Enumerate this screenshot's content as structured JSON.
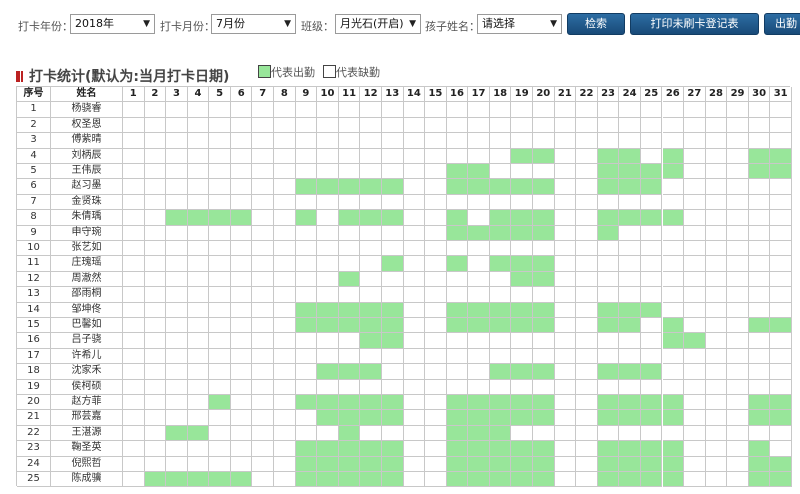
{
  "filters": {
    "year_label": "打卡年份：",
    "year_value": "2018年",
    "month_label": "打卡月份：",
    "month_value": "7月份",
    "class_label": "班级：",
    "class_value": "月光石(开启)",
    "child_label": "孩子姓名：",
    "child_value": "请选择"
  },
  "buttons": {
    "search": "检索",
    "print": "打印未刷卡登记表",
    "export": "出勤"
  },
  "section": {
    "title": "打卡统计(默认为:当月打卡日期)",
    "legend_present": "代表出勤",
    "legend_absent": "代表缺勤"
  },
  "colors": {
    "present": "#98e69a",
    "absent": "#ffffff",
    "accent_button": "#2a6496",
    "title_marker": "#b22222"
  },
  "table": {
    "headers": {
      "index": "序号",
      "name": "姓名"
    },
    "days": [
      "1",
      "2",
      "3",
      "4",
      "5",
      "6",
      "7",
      "8",
      "9",
      "10",
      "11",
      "12",
      "13",
      "14",
      "15",
      "16",
      "17",
      "18",
      "19",
      "20",
      "21",
      "22",
      "23",
      "24",
      "25",
      "26",
      "27",
      "28",
      "29",
      "30",
      "31"
    ],
    "rows": [
      {
        "index": "1",
        "name": "杨骁睿",
        "present": []
      },
      {
        "index": "2",
        "name": "权圣恩",
        "present": []
      },
      {
        "index": "3",
        "name": "傅紫晴",
        "present": []
      },
      {
        "index": "4",
        "name": "刘柄辰",
        "present": [
          19,
          20,
          23,
          24,
          26,
          30,
          31
        ]
      },
      {
        "index": "5",
        "name": "王伟辰",
        "present": [
          16,
          17,
          23,
          24,
          25,
          26,
          30,
          31
        ]
      },
      {
        "index": "6",
        "name": "赵习墨",
        "present": [
          9,
          10,
          11,
          12,
          13,
          16,
          17,
          18,
          19,
          20,
          23,
          24,
          25
        ]
      },
      {
        "index": "7",
        "name": "金贤珠",
        "present": []
      },
      {
        "index": "8",
        "name": "朱倩瑀",
        "present": [
          3,
          4,
          5,
          6,
          9,
          11,
          12,
          13,
          16,
          18,
          19,
          20,
          23,
          24,
          25,
          26
        ]
      },
      {
        "index": "9",
        "name": "申守琬",
        "present": [
          16,
          17,
          18,
          19,
          20,
          23
        ]
      },
      {
        "index": "10",
        "name": "张艺如",
        "present": []
      },
      {
        "index": "11",
        "name": "庄瑰瑶",
        "present": [
          13,
          16,
          18,
          19,
          20
        ]
      },
      {
        "index": "12",
        "name": "周澈然",
        "present": [
          11,
          19,
          20
        ]
      },
      {
        "index": "13",
        "name": "邵雨桐",
        "present": []
      },
      {
        "index": "14",
        "name": "邹坤佟",
        "present": [
          9,
          10,
          11,
          12,
          13,
          16,
          17,
          18,
          19,
          20,
          23,
          24,
          25
        ]
      },
      {
        "index": "15",
        "name": "巴馨如",
        "present": [
          9,
          10,
          11,
          12,
          13,
          16,
          17,
          18,
          19,
          20,
          23,
          24,
          26,
          30,
          31
        ]
      },
      {
        "index": "16",
        "name": "吕子骁",
        "present": [
          12,
          13,
          26,
          27
        ]
      },
      {
        "index": "17",
        "name": "许希儿",
        "present": []
      },
      {
        "index": "18",
        "name": "沈家禾",
        "present": [
          10,
          11,
          12,
          18,
          19,
          20,
          23,
          24,
          25
        ]
      },
      {
        "index": "19",
        "name": "侯柯硕",
        "present": []
      },
      {
        "index": "20",
        "name": "赵方菲",
        "present": [
          5,
          9,
          10,
          11,
          12,
          13,
          16,
          17,
          18,
          19,
          20,
          23,
          24,
          25,
          26,
          30,
          31
        ]
      },
      {
        "index": "21",
        "name": "邢芸嘉",
        "present": [
          10,
          11,
          12,
          13,
          16,
          17,
          18,
          19,
          20,
          23,
          24,
          25,
          26,
          30,
          31
        ]
      },
      {
        "index": "22",
        "name": "王湛源",
        "present": [
          3,
          4,
          11,
          16,
          17,
          18
        ]
      },
      {
        "index": "23",
        "name": "鞠圣英",
        "present": [
          9,
          10,
          11,
          12,
          13,
          16,
          17,
          18,
          19,
          20,
          23,
          24,
          25,
          26,
          30
        ]
      },
      {
        "index": "24",
        "name": "倪熙哲",
        "present": [
          9,
          10,
          11,
          12,
          13,
          16,
          17,
          18,
          19,
          20,
          23,
          24,
          25,
          26,
          30,
          31
        ]
      },
      {
        "index": "25",
        "name": "陈成骥",
        "present": [
          2,
          3,
          4,
          5,
          6,
          9,
          10,
          11,
          12,
          13,
          16,
          17,
          18,
          19,
          20,
          23,
          24,
          25,
          26,
          30,
          31
        ]
      }
    ]
  }
}
